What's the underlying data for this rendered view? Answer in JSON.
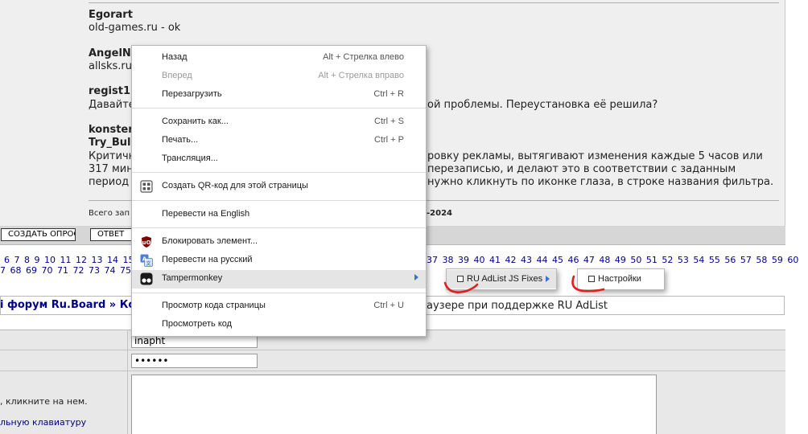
{
  "posts": [
    {
      "author": "Egorart",
      "text": "old-games.ru - ok"
    },
    {
      "author": "AngelN",
      "text": "allsks.ru"
    },
    {
      "author": "regist1",
      "text": "Давайте",
      "text_right": "ой проблемы. Переустановка её решила?"
    },
    {
      "author": "konster",
      "author2": "Try_Bul",
      "lines_left": [
        "Критичн",
        "317 мин",
        "период"
      ],
      "lines_right": [
        "ровку рекламы, вытягивают изменения каждые 5 часов или",
        "перезаписью, и делают это в соответствии с заданным",
        "нужно кликнуть по иконке глаза, в строке названия фильтра."
      ]
    }
  ],
  "footer": {
    "total_prefix": "Всего зап",
    "date_suffix": "-2024"
  },
  "buttons": {
    "create_poll": "СОЗДАТЬ ОПРОС",
    "reply": "ОТВЕТ"
  },
  "pagination": {
    "row1_left": "6 7 8 9 10 11 12 13 14 15 1",
    "row1_right": "37 38 39 40 41 42 43 44 45 46 47 48 49 50 51 52 53 54 55 56 57 58 59 60",
    "row2": "7 68 69 70 71 72 73 74 75 7"
  },
  "breadcrumb": {
    "text": "i форум Ru.Board » Ко",
    "topic_tail": "аузере при поддержке RU AdList"
  },
  "form": {
    "login_value": "inapht",
    "password_value": "••••••",
    "hint_click": ", кликните на нем.",
    "hint_keyboard": "льную клавиатуру"
  },
  "context_menu": {
    "items": [
      {
        "label": "Назад",
        "shortcut": "Alt + Стрелка влево",
        "disabled": false
      },
      {
        "label": "Вперед",
        "shortcut": "Alt + Стрелка вправо",
        "disabled": true
      },
      {
        "label": "Перезагрузить",
        "shortcut": "Ctrl + R",
        "disabled": false
      },
      {
        "label": "Сохранить как...",
        "shortcut": "Ctrl + S",
        "disabled": false
      },
      {
        "label": "Печать...",
        "shortcut": "Ctrl + P",
        "disabled": false
      },
      {
        "label": "Трансляция...",
        "shortcut": "",
        "disabled": false
      },
      {
        "label": "Создать QR-код для этой страницы",
        "shortcut": "",
        "icon": "qr-code-icon"
      },
      {
        "label": "Перевести на English",
        "shortcut": ""
      },
      {
        "label": "Блокировать элемент...",
        "shortcut": "",
        "icon": "ublock-origin-icon"
      },
      {
        "label": "Перевести на русский",
        "shortcut": "",
        "icon": "translate-icon"
      },
      {
        "label": "Tampermonkey",
        "shortcut": "",
        "icon": "tampermonkey-icon",
        "highlighted": true
      },
      {
        "label": "Просмотр кода страницы",
        "shortcut": "Ctrl + U"
      },
      {
        "label": "Просмотреть код",
        "shortcut": ""
      }
    ]
  },
  "submenu1": {
    "label": "RU AdList JS Fixes"
  },
  "submenu2": {
    "label": "Настройки"
  },
  "colors": {
    "link": "#00008b",
    "highlight": "#e5e5e5",
    "annotation": "#e02020",
    "submenu_arrow": "#3b6fd0"
  }
}
